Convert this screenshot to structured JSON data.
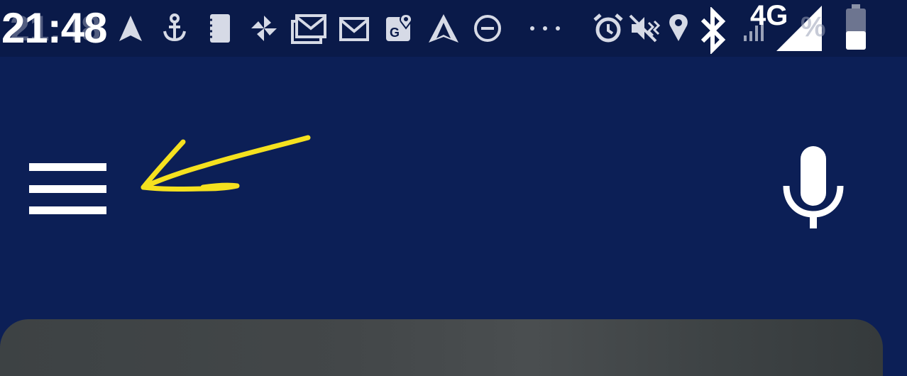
{
  "status_bar": {
    "time": "21:48",
    "time_ghost": "21:48",
    "network_type": "4G",
    "battery_ghost": "%",
    "notification_icons": [
      "navigation-arrow-icon",
      "anchor-icon",
      "notes-icon",
      "pinwheel-icon",
      "gmail-stack-icon",
      "gmail-icon",
      "google-maps-icon",
      "android-auto-icon",
      "do-not-disturb-icon",
      "more-dots-icon"
    ],
    "system_icons": [
      "alarm-icon",
      "vibrate-icon",
      "location-icon",
      "bluetooth-icon",
      "signal-bars-icon",
      "cell-signal-icon",
      "battery-icon"
    ]
  },
  "app_bar": {
    "menu_icon": "hamburger-menu-icon",
    "voice_icon": "microphone-icon"
  },
  "annotation": {
    "color": "#f5e11f"
  },
  "colors": {
    "status_bar_bg": "#0a1a49",
    "app_bg": "#0c1f56",
    "icon": "#ffffff",
    "card_bg": "#434749"
  }
}
